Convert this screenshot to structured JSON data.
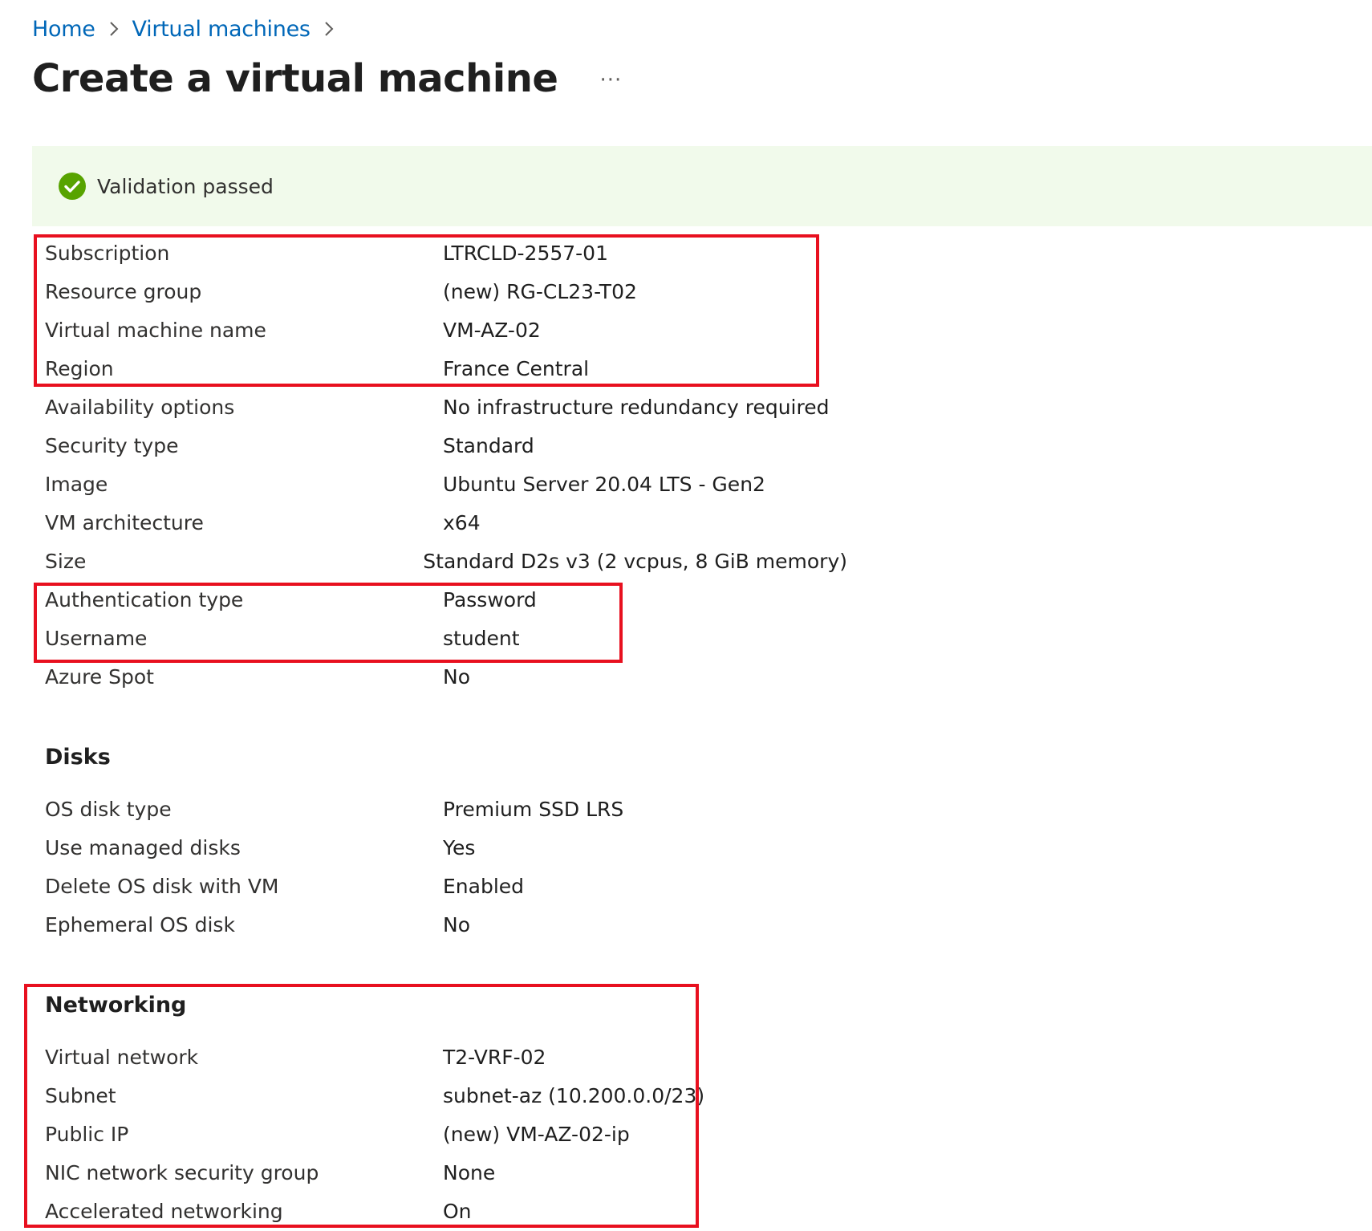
{
  "breadcrumb": {
    "items": [
      "Home",
      "Virtual machines"
    ]
  },
  "page": {
    "title": "Create a virtual machine",
    "more_label": "···"
  },
  "validation": {
    "text": "Validation passed",
    "status_color": "#57a300",
    "icon": "check-circle-icon"
  },
  "basics": [
    {
      "label": "Subscription",
      "value": "LTRCLD-2557-01"
    },
    {
      "label": "Resource group",
      "value": "(new) RG-CL23-T02"
    },
    {
      "label": "Virtual machine name",
      "value": "VM-AZ-02"
    },
    {
      "label": "Region",
      "value": "France Central"
    },
    {
      "label": "Availability options",
      "value": "No infrastructure redundancy required"
    },
    {
      "label": "Security type",
      "value": "Standard"
    },
    {
      "label": "Image",
      "value": "Ubuntu Server 20.04 LTS - Gen2"
    },
    {
      "label": "VM architecture",
      "value": "x64"
    },
    {
      "label": "Size",
      "value": "Standard D2s v3 (2 vcpus, 8 GiB memory)"
    },
    {
      "label": "Authentication type",
      "value": "Password"
    },
    {
      "label": "Username",
      "value": "student"
    },
    {
      "label": "Azure Spot",
      "value": "No"
    }
  ],
  "disks": {
    "heading": "Disks",
    "rows": [
      {
        "label": "OS disk type",
        "value": "Premium SSD LRS"
      },
      {
        "label": "Use managed disks",
        "value": "Yes"
      },
      {
        "label": "Delete OS disk with VM",
        "value": "Enabled"
      },
      {
        "label": "Ephemeral OS disk",
        "value": "No"
      }
    ]
  },
  "networking": {
    "heading": "Networking",
    "rows": [
      {
        "label": "Virtual network",
        "value": "T2-VRF-02"
      },
      {
        "label": "Subnet",
        "value": "subnet-az (10.200.0.0/23)"
      },
      {
        "label": "Public IP",
        "value": "(new) VM-AZ-02-ip"
      },
      {
        "label": "NIC network security group",
        "value": "None"
      },
      {
        "label": "Accelerated networking",
        "value": "On"
      }
    ]
  },
  "colors": {
    "link": "#0067b8",
    "banner_bg": "#f1faeb",
    "highlight": "#e8101f"
  }
}
